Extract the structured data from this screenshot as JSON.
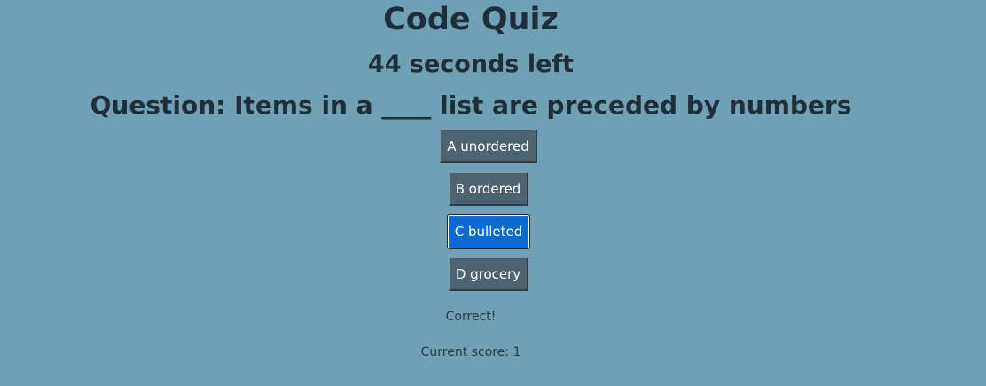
{
  "header": {
    "title": "Code Quiz",
    "timer_text": "44 seconds left"
  },
  "quiz": {
    "question": "Question: Items in a ____ list are preceded by numbers",
    "choices": [
      {
        "label": "A unordered"
      },
      {
        "label": "B ordered"
      },
      {
        "label": "C bulleted"
      },
      {
        "label": "D grocery"
      }
    ],
    "selected_index": 2,
    "feedback": "Correct!",
    "score_text": "Current score: 1"
  },
  "colors": {
    "background": "#70a0b5",
    "button": "#4b6470",
    "button_selected": "#0a6ad4",
    "text": "#1f2f3a"
  }
}
